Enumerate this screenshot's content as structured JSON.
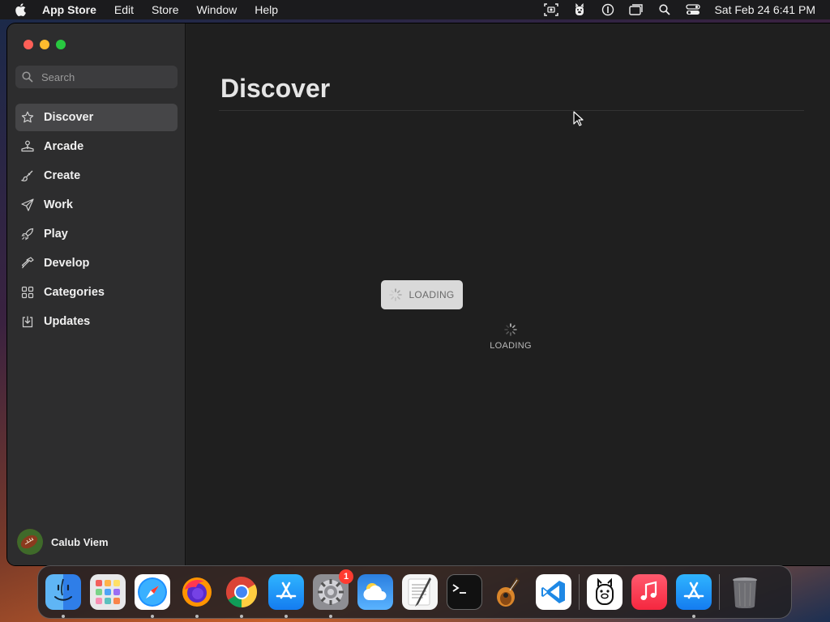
{
  "menubar": {
    "app_name": "App Store",
    "menus": [
      "Edit",
      "Store",
      "Window",
      "Help"
    ],
    "clock": "Sat Feb 24  6:41 PM"
  },
  "sidebar": {
    "search_placeholder": "Search",
    "items": [
      {
        "label": "Discover",
        "icon": "star-icon",
        "active": true
      },
      {
        "label": "Arcade",
        "icon": "joystick-icon"
      },
      {
        "label": "Create",
        "icon": "brush-icon"
      },
      {
        "label": "Work",
        "icon": "paperplane-icon"
      },
      {
        "label": "Play",
        "icon": "rocket-icon"
      },
      {
        "label": "Develop",
        "icon": "hammer-icon"
      },
      {
        "label": "Categories",
        "icon": "grid-icon"
      },
      {
        "label": "Updates",
        "icon": "download-icon"
      }
    ],
    "user": {
      "name": "Calub Viem"
    }
  },
  "main": {
    "title": "Discover",
    "loading_button": "LOADING",
    "loading_indicator": "LOADING"
  },
  "dock": {
    "items": [
      "Finder",
      "Launchpad",
      "Safari",
      "Firefox",
      "Chrome",
      "App Store",
      "System Settings",
      "Weather",
      "TextEdit",
      "Terminal",
      "GarageBand",
      "Visual Studio Code",
      "Ollama",
      "Music",
      "App Store",
      "Trash"
    ],
    "settings_badge": "1"
  }
}
